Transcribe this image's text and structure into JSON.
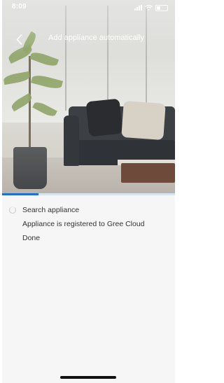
{
  "status_bar": {
    "time": "8:09"
  },
  "header": {
    "title": "Add appliance automatically",
    "back_icon": "chevron-left-icon"
  },
  "progress": {
    "fraction": 0.21,
    "color": "#1f6fd0"
  },
  "steps": [
    {
      "label": "Search appliance",
      "state": "in-progress"
    },
    {
      "label": "Appliance is registered to Gree Cloud",
      "state": "pending"
    },
    {
      "label": "Done",
      "state": "pending"
    }
  ]
}
